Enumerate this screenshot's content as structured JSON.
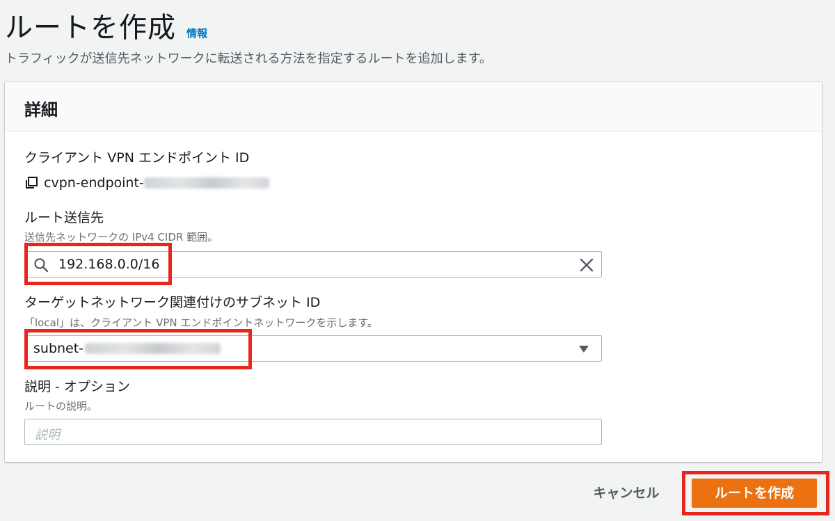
{
  "header": {
    "title": "ルートを作成",
    "info_link": "情報",
    "description": "トラフィックが送信先ネットワークに転送される方法を指定するルートを追加します。"
  },
  "panel": {
    "title": "詳細",
    "endpoint": {
      "label": "クライアント VPN エンドポイント ID",
      "value_prefix": "cvpn-endpoint-",
      "icon": "copy-icon"
    },
    "destination": {
      "label": "ルート送信先",
      "description": "送信先ネットワークの IPv4 CIDR 範囲。",
      "value": "192.168.0.0/16",
      "search_icon": "search-icon",
      "clear_icon": "close-icon"
    },
    "subnet": {
      "label": "ターゲットネットワーク関連付けのサブネット ID",
      "description": "「local」は、クライアント VPN エンドポイントネットワークを示します。",
      "value_prefix": "subnet-",
      "icon": "caret-down-icon"
    },
    "description_field": {
      "label": "説明 - オプション",
      "description": "ルートの説明。",
      "placeholder": "説明"
    }
  },
  "actions": {
    "cancel_label": "キャンセル",
    "create_label": "ルートを作成"
  },
  "colors": {
    "primary_button": "#ec7211",
    "link": "#0073bb",
    "highlight_box": "#e8261c",
    "page_background": "#f2f3f3"
  }
}
